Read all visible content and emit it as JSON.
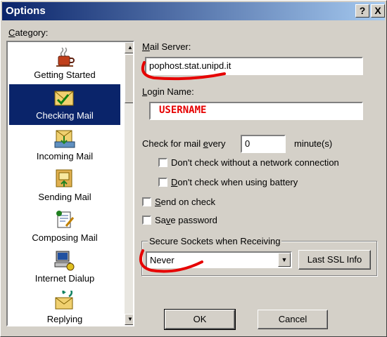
{
  "window": {
    "title": "Options",
    "help_btn": "?",
    "close_btn": "X"
  },
  "category": {
    "label_prefix": "",
    "label_u": "C",
    "label_rest": "ategory:",
    "items": [
      {
        "label": "Getting Started",
        "icon": "coffee-mug-icon"
      },
      {
        "label": "Checking Mail",
        "icon": "check-mail-envelope-icon",
        "selected": true
      },
      {
        "label": "Incoming Mail",
        "icon": "incoming-mail-icon"
      },
      {
        "label": "Sending Mail",
        "icon": "sending-mail-icon"
      },
      {
        "label": "Composing Mail",
        "icon": "composing-mail-icon"
      },
      {
        "label": "Internet Dialup",
        "icon": "computer-modem-icon"
      },
      {
        "label": "Replying",
        "icon": "replying-mail-icon"
      }
    ]
  },
  "mail_server": {
    "label_u": "M",
    "label_rest": "ail Server:",
    "value": "pophost.stat.unipd.it"
  },
  "login_name": {
    "label_u": "L",
    "label_rest": "ogin Name:",
    "value": "USERNAME"
  },
  "check_every": {
    "label_pre": "Check for mail ",
    "label_u": "e",
    "label_rest": "very",
    "value": "0",
    "unit": "minute(s)"
  },
  "options": {
    "no_network": {
      "pre": "Don't check without a network connection",
      "u": "",
      "rest": ""
    },
    "battery": {
      "pre": "",
      "u": "D",
      "rest": "on't check when using battery"
    },
    "send_on_check": {
      "pre": "",
      "u": "S",
      "rest": "end on check"
    },
    "save_password": {
      "pre": "Sa",
      "u": "v",
      "rest": "e password"
    }
  },
  "ssl": {
    "group_label": "Secure Sockets when Receiving",
    "value": "Never",
    "info_button": "Last SSL Info"
  },
  "buttons": {
    "ok": "OK",
    "cancel": "Cancel"
  },
  "colors": {
    "annotation": "#e60000",
    "selection": "#0a246a"
  }
}
